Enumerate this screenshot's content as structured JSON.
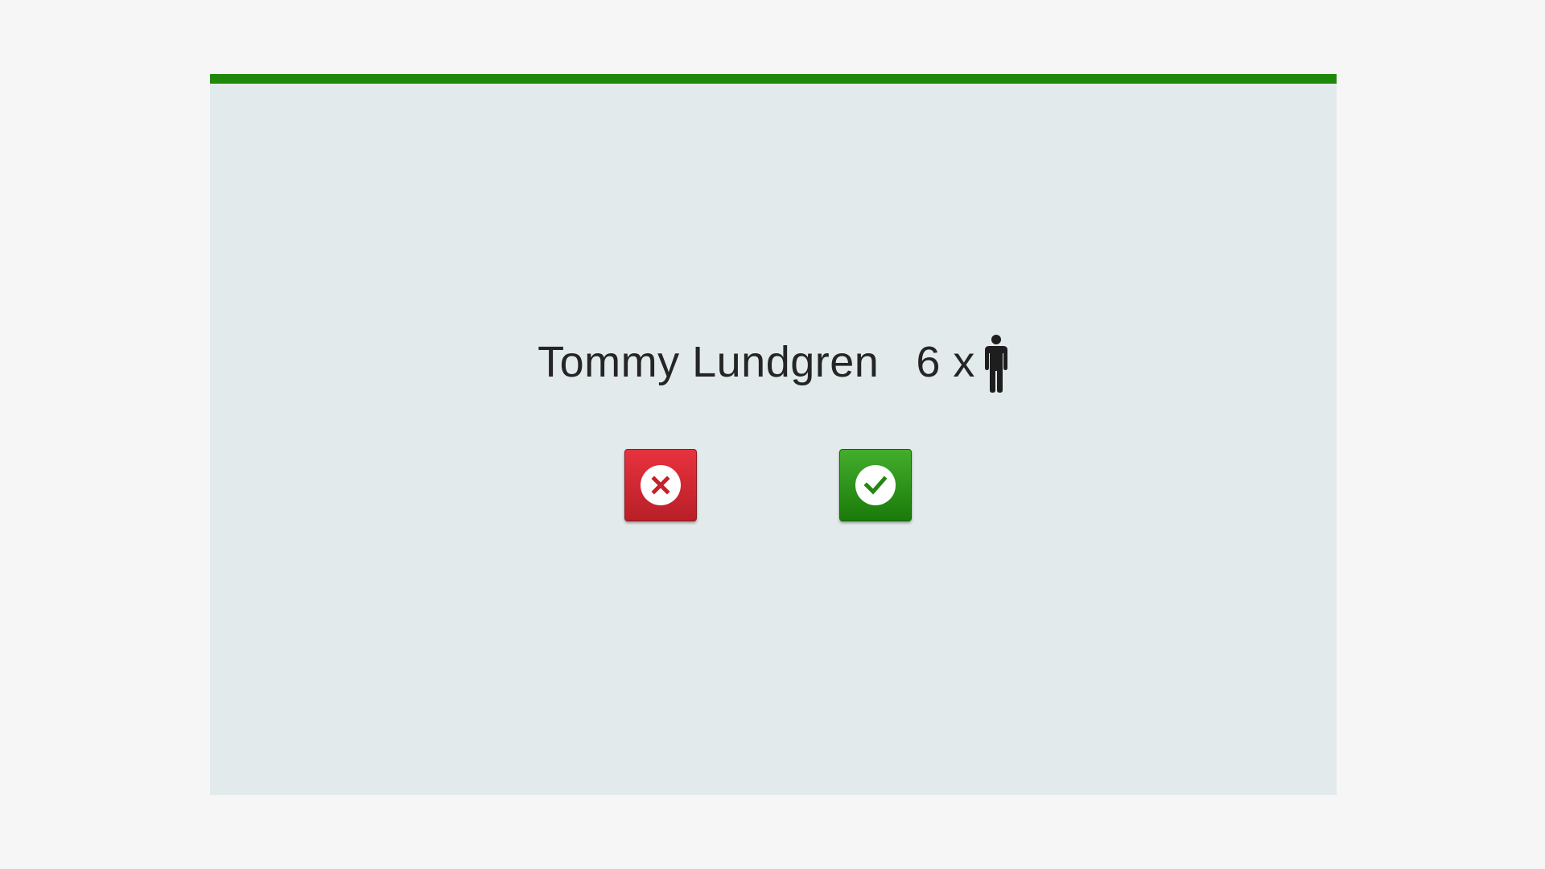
{
  "booking_prompt": {
    "guest_name": "Tommy Lundgren",
    "party_size_text": "6 x",
    "party_icon": "person-icon"
  },
  "actions": {
    "decline_icon": "close-icon",
    "accept_icon": "check-icon"
  },
  "colors": {
    "top_bar": "#1f880b",
    "panel_background": "#e3eaeb",
    "decline": "#d3262f",
    "accept": "#2e9a1a",
    "text": "#252525"
  }
}
